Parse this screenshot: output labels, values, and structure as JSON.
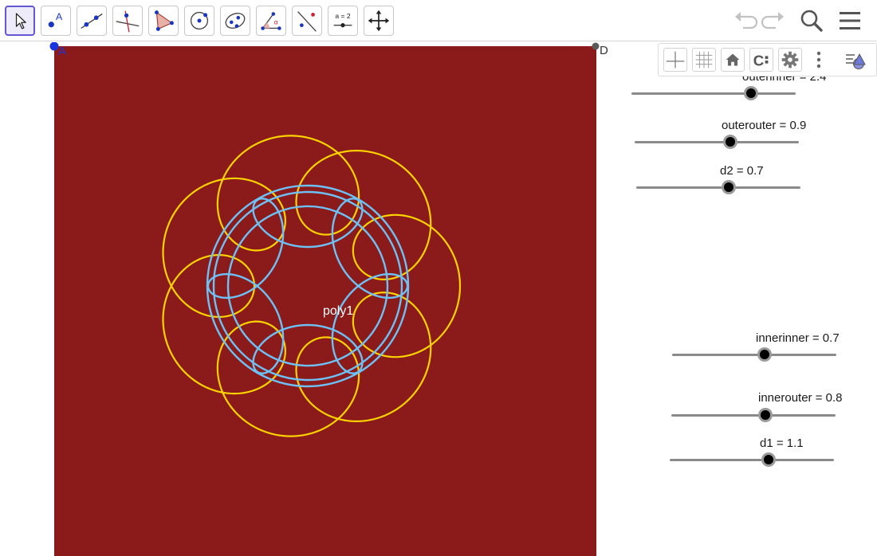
{
  "toolbar": {
    "tools": [
      {
        "name": "move-tool",
        "label": "Move"
      },
      {
        "name": "point-tool",
        "label": "Point",
        "glyph": "A"
      },
      {
        "name": "line-tool",
        "label": "Line"
      },
      {
        "name": "perpendicular-line-tool",
        "label": "Perpendicular Line"
      },
      {
        "name": "polygon-tool",
        "label": "Polygon"
      },
      {
        "name": "circle-center-point-tool",
        "label": "Circle with Center through Point"
      },
      {
        "name": "ellipse-tool",
        "label": "Ellipse"
      },
      {
        "name": "angle-tool",
        "label": "Angle",
        "glyph": "α"
      },
      {
        "name": "reflect-tool",
        "label": "Reflect about Line"
      },
      {
        "name": "slider-tool",
        "label": "Slider",
        "glyph": "a = 2"
      },
      {
        "name": "move-graphics-view-tool",
        "label": "Move Graphics View"
      }
    ]
  },
  "stylebar": {
    "items": [
      "axes-toggle",
      "grid-toggle",
      "standard-view",
      "point-capturing",
      "graphics-settings",
      "more-options",
      "toggle-stylebar"
    ],
    "capture_label": "C"
  },
  "canvas": {
    "points": {
      "A": "A",
      "D": "D"
    },
    "poly_label": "poly1",
    "colors": {
      "background": "#8B1A1A",
      "outer_curve": "#FFD200",
      "inner_curve": "#6EC1F5",
      "point_A": "#1a35e0",
      "point_D": "#5a5a5a"
    }
  },
  "sliders": [
    {
      "id": "outerinner",
      "label": "outerinner = 2.4",
      "value": 2.4
    },
    {
      "id": "outerouter",
      "label": "outerouter = 0.9",
      "value": 0.9
    },
    {
      "id": "d2",
      "label": "d2 = 0.7",
      "value": 0.7
    },
    {
      "id": "innerinner",
      "label": "innerinner = 0.7",
      "value": 0.7
    },
    {
      "id": "innerouter",
      "label": "innerouter = 0.8",
      "value": 0.8
    },
    {
      "id": "d1",
      "label": "d1 = 1.1",
      "value": 1.1
    }
  ]
}
